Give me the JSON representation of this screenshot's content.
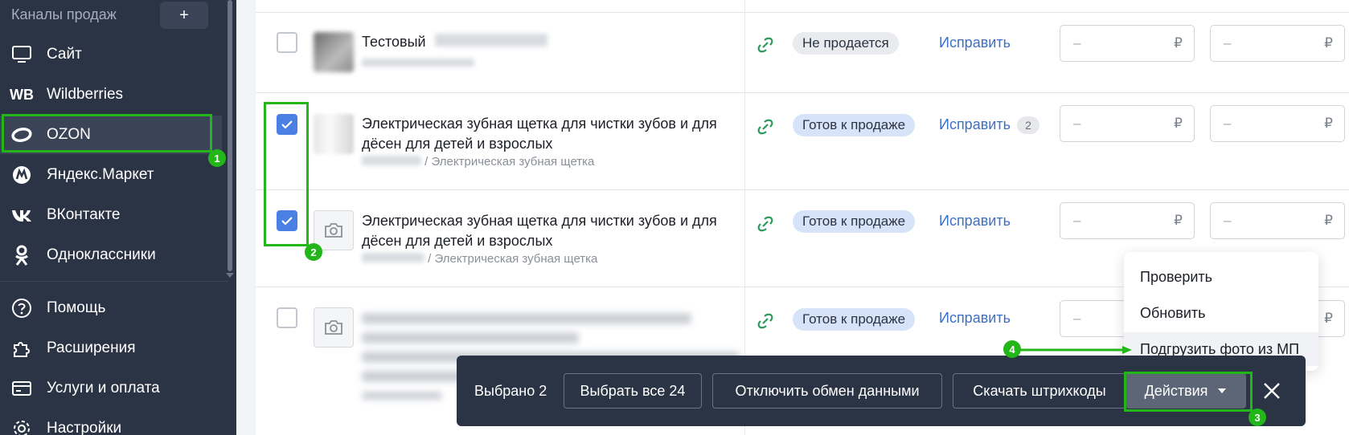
{
  "sidebar": {
    "section_title": "Каналы продаж",
    "add_label": "+",
    "items": [
      {
        "label": "Сайт",
        "icon": "monitor-icon"
      },
      {
        "label": "Wildberries",
        "icon": "wb-logo"
      },
      {
        "label": "OZON",
        "icon": "ozon-logo",
        "active": true
      },
      {
        "label": "Яндекс.Маркет",
        "icon": "yandex-market-logo"
      },
      {
        "label": "ВКонтакте",
        "icon": "vk-logo"
      },
      {
        "label": "Одноклассники",
        "icon": "ok-logo"
      }
    ],
    "bottom_items": [
      {
        "label": "Помощь",
        "icon": "help-icon"
      },
      {
        "label": "Расширения",
        "icon": "puzzle-icon"
      },
      {
        "label": "Услуги и оплата",
        "icon": "card-icon"
      },
      {
        "label": "Настройки",
        "icon": "gear-icon"
      }
    ],
    "wb_mark": "WB"
  },
  "products": [
    {
      "title": "Тестовый",
      "checked": false,
      "status": "Не продается",
      "fix": "Исправить",
      "fix_count": null
    },
    {
      "title_line1": "Электрическая зубная щетка для чистки зубов и для",
      "title_line2": "дёсен для детей и взрослых",
      "sub": "/ Электрическая зубная щетка",
      "checked": true,
      "status": "Готов к продаже",
      "fix": "Исправить",
      "fix_count": "2"
    },
    {
      "title_line1": "Электрическая зубная щетка для чистки зубов и для",
      "title_line2": "дёсен для детей и взрослых",
      "sub": "/ Электрическая зубная щетка",
      "checked": true,
      "status": "Готов к продаже",
      "fix": "Исправить",
      "fix_count": null
    },
    {
      "title": "",
      "checked": false,
      "status": "Готов к продаже",
      "fix": "Исправить",
      "fix_count": null
    }
  ],
  "price": {
    "dash": "–",
    "currency": "₽"
  },
  "menu": {
    "items": [
      "Проверить",
      "Обновить",
      "Подгрузить фото из МП"
    ]
  },
  "action_bar": {
    "selected_label": "Выбрано 2",
    "select_all": "Выбрать все 24",
    "disable_exchange": "Отключить обмен данными",
    "download_barcodes": "Скачать штрихкоды",
    "actions": "Действия"
  },
  "annotations": [
    "1",
    "2",
    "3",
    "4"
  ],
  "colors": {
    "sidebar_bg": "#2b3444",
    "accent_blue": "#4a7fe4",
    "annotation_green": "#22b619",
    "link_blue": "#3a6fcb"
  }
}
